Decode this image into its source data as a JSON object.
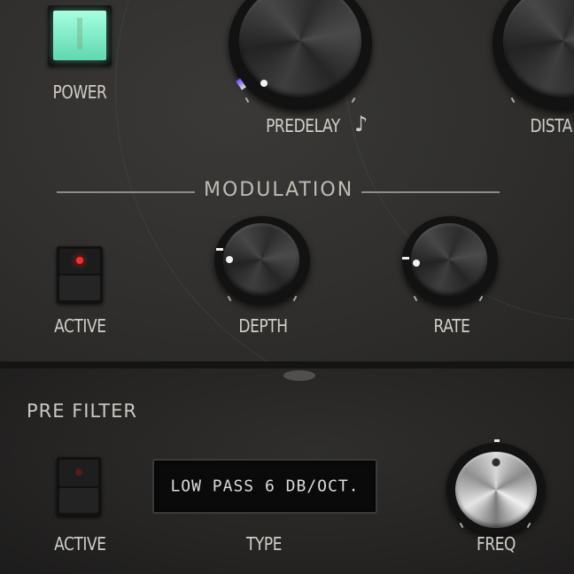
{
  "reverb_section": {
    "power_label": "POWER",
    "predelay_label": "PREDELAY",
    "predelay_sync_icon": "music-note-icon",
    "distance_label": "DISTA"
  },
  "modulation": {
    "title": "MODULATION",
    "active_label": "ACTIVE",
    "depth_label": "DEPTH",
    "rate_label": "RATE",
    "led_color": "#ff2a2a"
  },
  "pre_filter": {
    "title": "PRE FILTER",
    "active_label": "ACTIVE",
    "type_label": "TYPE",
    "type_value": "LOW PASS 6 DB/OCT.",
    "freq_label": "FREQ"
  },
  "colors": {
    "power_on": "#7de8c4",
    "accent_indicator": "#6a4cff"
  }
}
